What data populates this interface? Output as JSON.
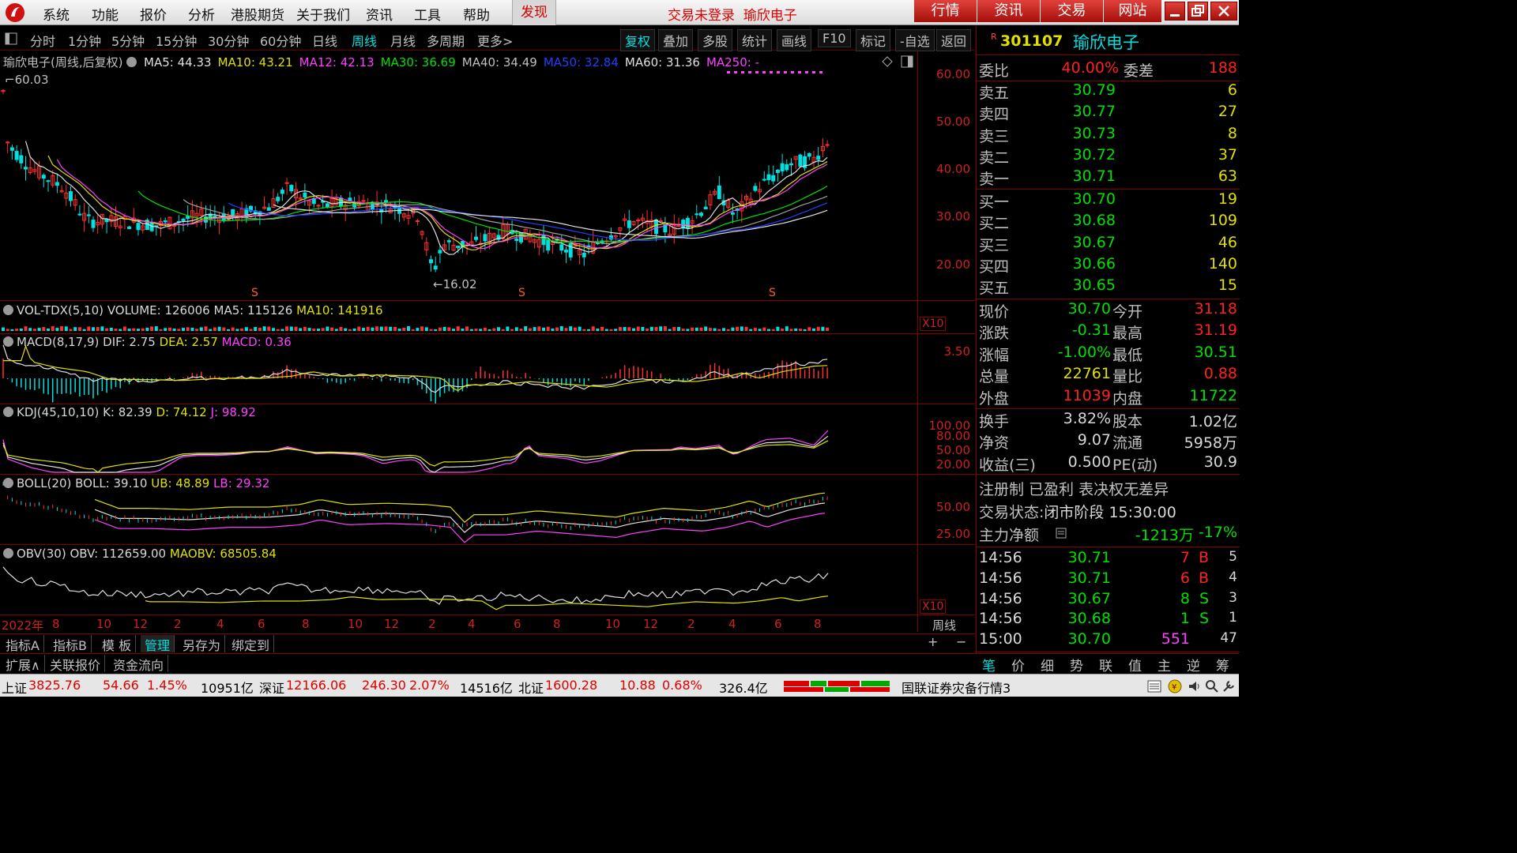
{
  "menu": {
    "items": [
      "系统",
      "功能",
      "报价",
      "分析",
      "港股期货",
      "关于我们",
      "资讯",
      "工具",
      "帮助"
    ],
    "find": "发现",
    "login_msg": "交易未登录",
    "stock_name": "瑜欣电子",
    "right_tabs": [
      "行情",
      "资讯",
      "交易",
      "网站"
    ]
  },
  "periods": {
    "items": [
      "分时",
      "1分钟",
      "5分钟",
      "15分钟",
      "30分钟",
      "60分钟",
      "日线",
      "周线",
      "月线",
      "多周期",
      "更多>"
    ],
    "selected": "周线"
  },
  "toolbar": [
    "复权",
    "叠加",
    "多股",
    "统计",
    "画线",
    "F10",
    "标记",
    "-自选",
    "返回"
  ],
  "main_chart": {
    "title": "瑜欣电子(周线,后复权)",
    "ma": [
      {
        "label": "MA5: 44.33",
        "color": "#e0e0e0"
      },
      {
        "label": "MA10: 43.21",
        "color": "#e0e000"
      },
      {
        "label": "MA12: 42.13",
        "color": "#ff40ff"
      },
      {
        "label": "MA30: 36.69",
        "color": "#00e000"
      },
      {
        "label": "MA40: 34.49",
        "color": "#c0c0c0"
      },
      {
        "label": "MA50: 32.84",
        "color": "#2040ff"
      },
      {
        "label": "MA60: 31.36",
        "color": "#e0e0e0"
      },
      {
        "label": "MA250: -",
        "color": "#ff40ff"
      }
    ],
    "high_label": "60.03",
    "low_label": "16.02",
    "y_ticks": [
      "60.00",
      "50.00",
      "40.00",
      "30.00",
      "20.00"
    ],
    "markers": [
      "S",
      "S",
      "S"
    ]
  },
  "vol": {
    "name": "VOL-TDX(5,10)",
    "volume": "VOLUME: 126006",
    "ma5": "MA5: 115126",
    "ma10": "MA10: 141916",
    "x10": "X10"
  },
  "macd": {
    "name": "MACD(8,17,9)",
    "dif": "DIF: 2.75",
    "dea": "DEA: 2.57",
    "macd": "MACD: 0.36",
    "tick": "3.50"
  },
  "kdj": {
    "name": "KDJ(45,10,10)",
    "k": "K: 82.39",
    "d": "D: 74.12",
    "j": "J: 98.92",
    "ticks": [
      "100.00",
      "80.00",
      "50.00",
      "20.00"
    ]
  },
  "boll": {
    "name": "BOLL(20)",
    "boll": "BOLL: 39.10",
    "ub": "UB: 48.89",
    "lb": "LB: 29.32",
    "ticks": [
      "50.00",
      "25.00"
    ]
  },
  "obv": {
    "name": "OBV(30)",
    "obv": "OBV: 112659.00",
    "maobv": "MAOBV: 68505.84",
    "x10": "X10"
  },
  "xaxis": [
    "2022年",
    "8",
    "10",
    "12",
    "2",
    "4",
    "6",
    "8",
    "10",
    "12",
    "2",
    "4",
    "6",
    "8",
    "10",
    "12",
    "2",
    "4",
    "6",
    "8"
  ],
  "xaxis_right": "周线",
  "bottom_tabs": [
    "指标A",
    "指标B",
    "模 板",
    "管理",
    "另存为",
    "绑定到"
  ],
  "bottom_tabs_active": "管理",
  "bottom_plus": "+",
  "bottom_minus": "−",
  "bottom2_tabs": [
    "扩展∧",
    "关联报价",
    "资金流向"
  ],
  "quote": {
    "code": "301107",
    "name": "瑜欣电子",
    "r_mark": "R",
    "weibi_label": "委比",
    "weibi": "40.00%",
    "weicha_label": "委差",
    "weicha": "188",
    "asks": [
      {
        "label": "卖五",
        "price": "30.79",
        "vol": "6"
      },
      {
        "label": "卖四",
        "price": "30.77",
        "vol": "27"
      },
      {
        "label": "卖三",
        "price": "30.73",
        "vol": "8"
      },
      {
        "label": "卖二",
        "price": "30.72",
        "vol": "37"
      },
      {
        "label": "卖一",
        "price": "30.71",
        "vol": "63"
      }
    ],
    "bids": [
      {
        "label": "买一",
        "price": "30.70",
        "vol": "19"
      },
      {
        "label": "买二",
        "price": "30.68",
        "vol": "109"
      },
      {
        "label": "买三",
        "price": "30.67",
        "vol": "46"
      },
      {
        "label": "买四",
        "price": "30.66",
        "vol": "140"
      },
      {
        "label": "买五",
        "price": "30.65",
        "vol": "15"
      }
    ],
    "stats": [
      {
        "l1": "现价",
        "v1": "30.70",
        "l2": "今开",
        "v2": "31.18",
        "c1": "g",
        "c2": "r"
      },
      {
        "l1": "涨跌",
        "v1": "-0.31",
        "l2": "最高",
        "v2": "31.19",
        "c1": "g",
        "c2": "r"
      },
      {
        "l1": "涨幅",
        "v1": "-1.00%",
        "l2": "最低",
        "v2": "30.51",
        "c1": "g",
        "c2": "g"
      },
      {
        "l1": "总量",
        "v1": "22761",
        "l2": "量比",
        "v2": "0.88",
        "c1": "y",
        "c2": "r"
      },
      {
        "l1": "外盘",
        "v1": "11039",
        "l2": "内盘",
        "v2": "11722",
        "c1": "r",
        "c2": "g"
      }
    ],
    "stats2": [
      {
        "l1": "换手",
        "v1": "3.82%",
        "l2": "股本",
        "v2": "1.02亿"
      },
      {
        "l1": "净资",
        "v1": "9.07",
        "l2": "流通",
        "v2": "5958万"
      },
      {
        "l1": "收益(三)",
        "v1": "0.500",
        "l2": "PE(动)",
        "v2": "30.9"
      }
    ],
    "tags": "注册制 已盈利 表决权无差异",
    "trade_status_label": "交易状态:",
    "trade_status": "闭市阶段 15:30:00",
    "main_net_label": "主力净额",
    "main_net": "-1213万",
    "main_net_pct": "-17%",
    "ticks": [
      {
        "time": "14:56",
        "price": "30.71",
        "vol": "7",
        "bs": "B",
        "n": "5"
      },
      {
        "time": "14:56",
        "price": "30.71",
        "vol": "6",
        "bs": "B",
        "n": "4"
      },
      {
        "time": "14:56",
        "price": "30.67",
        "vol": "8",
        "bs": "S",
        "n": "3"
      },
      {
        "time": "14:56",
        "price": "30.68",
        "vol": "1",
        "bs": "S",
        "n": "1"
      },
      {
        "time": "15:00",
        "price": "30.70",
        "vol": "551",
        "bs": "",
        "n": "47"
      }
    ],
    "bottom_tabs": [
      "笔",
      "价",
      "细",
      "势",
      "联",
      "值",
      "主",
      "逆",
      "筹"
    ]
  },
  "statusbar": {
    "sh_label": "上证",
    "sh": "3825.76",
    "sh_chg": "54.66",
    "sh_pct": "1.45%",
    "sh_amt": "10951亿",
    "sz_label": "深证",
    "sz": "12166.06",
    "sz_chg": "246.30",
    "sz_pct": "2.07%",
    "sz_amt": "14516亿",
    "bz_label": "北证",
    "bz": "1600.28",
    "bz_chg": "10.88",
    "bz_pct": "0.68%",
    "bz_amt": "326.4亿",
    "source": "国联证券灾备行情3"
  }
}
